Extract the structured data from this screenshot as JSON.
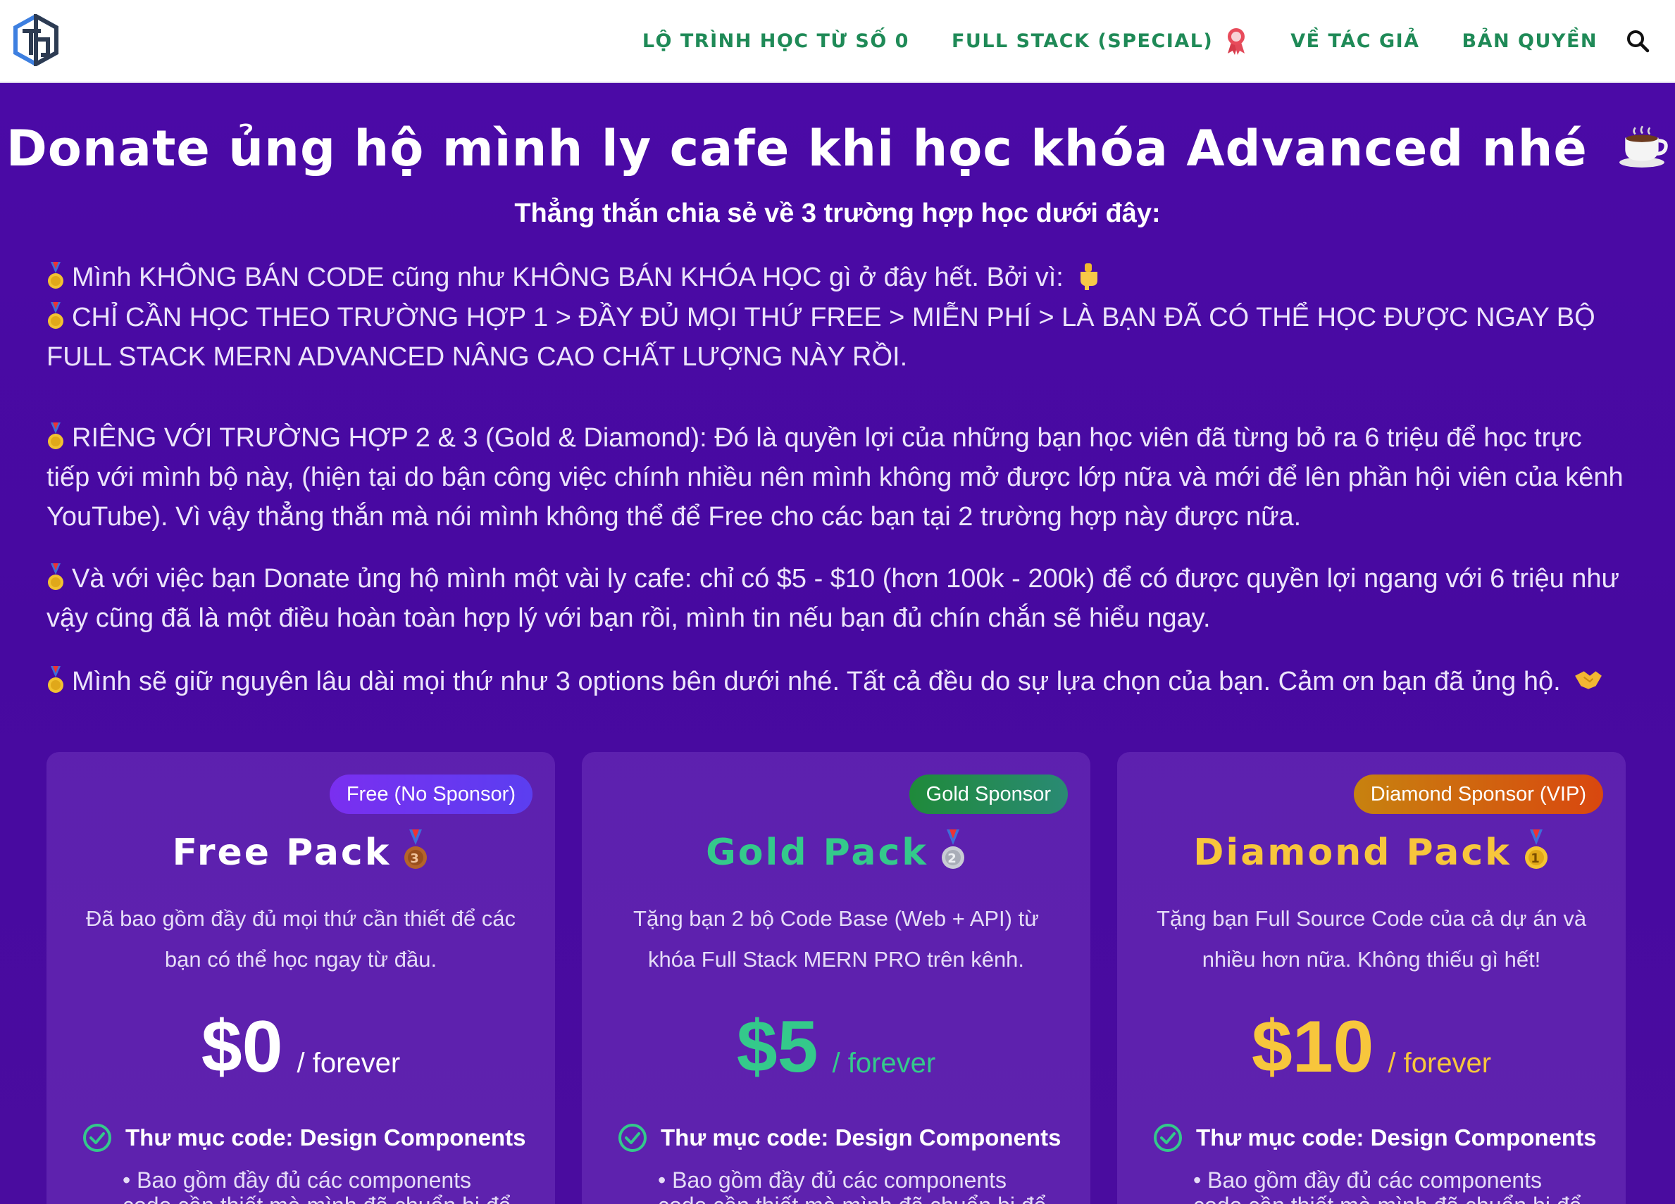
{
  "nav": {
    "items": [
      {
        "label": "LỘ TRÌNH HỌC TỪ SỐ 0"
      },
      {
        "label": "FULL STACK (SPECIAL)"
      },
      {
        "label": "VỀ TÁC GIẢ"
      },
      {
        "label": "BẢN QUYỀN"
      }
    ],
    "color": "#1f8a57"
  },
  "hero": {
    "title": "Donate ủng hộ mình ly cafe khi học khóa Advanced nhé",
    "subtitle": "Thẳng thắn chia sẻ về 3 trường hợp học dưới đây:"
  },
  "paragraphs": [
    "Mình KHÔNG BÁN CODE cũng như KHÔNG BÁN KHÓA HỌC gì ở đây hết. Bởi vì:",
    "CHỈ CẦN HỌC THEO TRƯỜNG HỢP 1 > ĐẦY ĐỦ MỌI THỨ FREE > MIỄN PHÍ > LÀ BẠN ĐÃ CÓ THỂ HỌC ĐƯỢC NGAY BỘ FULL STACK MERN ADVANCED NÂNG CAO CHẤT LƯỢNG NÀY RỒI.",
    "RIÊNG VỚI TRƯỜNG HỢP 2 & 3 (Gold & Diamond): Đó là quyền lợi của những bạn học viên đã từng bỏ ra 6 triệu để học trực tiếp với mình bộ này, (hiện tại do bận công việc chính nhiều nên mình không mở được lớp nữa và mới để lên phần hội viên của kênh YouTube). Vì vậy thẳng thắn mà nói mình không thể để Free cho các bạn tại 2 trường hợp này được nữa.",
    "Và với việc bạn Donate ủng hộ mình một vài ly cafe: chỉ có $5 - $10 (hơn 100k - 200k) để có được quyền lợi ngang với 6 triệu như vậy cũng đã là một điều hoàn toàn hợp lý với bạn rồi, mình tin nếu bạn đủ chín chắn sẽ hiểu ngay.",
    "Mình sẽ giữ nguyên lâu dài mọi thứ như 3 options bên dưới nhé. Tất cả đều do sự lựa chọn của bạn. Cảm ơn bạn đã ủng hộ."
  ],
  "cards": [
    {
      "badge": "Free (No Sponsor)",
      "title": "Free Pack",
      "medal": "bronze-medal-3",
      "description": "Đã bao gồm đầy đủ mọi thứ cần thiết để các bạn có thể học ngay từ đầu.",
      "price": "$0",
      "period": "/ forever",
      "accent": "#ffffff",
      "feature_title": "Thư mục code: Design Components",
      "feature_sub": "• Bao gồm đầy đủ các components code cần thiết mà mình đã chuẩn bị để"
    },
    {
      "badge": "Gold Sponsor",
      "title": "Gold Pack",
      "medal": "silver-medal-2",
      "description": "Tặng bạn 2 bộ Code Base (Web + API) từ khóa Full Stack MERN PRO trên kênh.",
      "price": "$5",
      "period": "/ forever",
      "accent": "#34c98b",
      "feature_title": "Thư mục code: Design Components",
      "feature_sub": "• Bao gồm đầy đủ các components code cần thiết mà mình đã chuẩn bị để"
    },
    {
      "badge": "Diamond Sponsor (VIP)",
      "title": "Diamond Pack",
      "medal": "gold-medal-1",
      "description": "Tặng bạn Full Source Code của cả dự án và nhiều hơn nữa. Không thiếu gì hết!",
      "price": "$10",
      "period": "/ forever",
      "accent": "#f7c63c",
      "feature_title": "Thư mục code: Design Components",
      "feature_sub": "• Bao gồm đầy đủ các components code cần thiết mà mình đã chuẩn bị để"
    }
  ],
  "colors": {
    "background": "#4a0aa0",
    "badge_free": "#6a2cf0",
    "badge_gold": "#1f8a57",
    "badge_diamond": "#d9650f",
    "check": "#34c98b"
  }
}
